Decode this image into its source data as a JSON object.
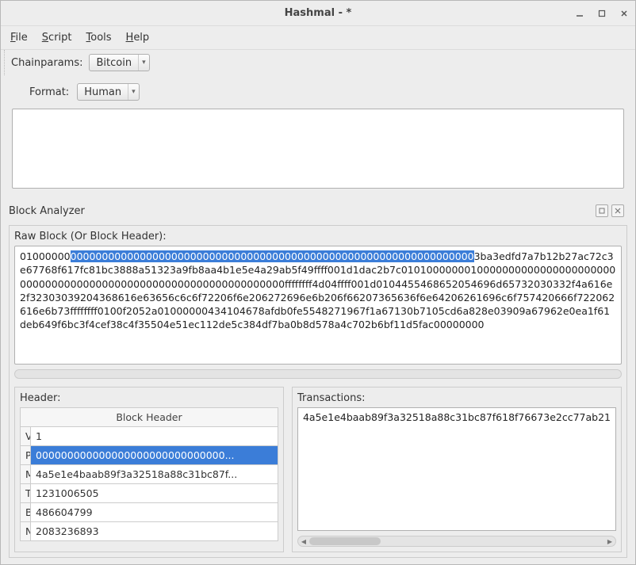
{
  "window": {
    "title": "Hashmal -  *"
  },
  "menu": {
    "file": "File",
    "script": "Script",
    "tools": "Tools",
    "help": "Help"
  },
  "toolbar": {
    "chainparams_label": "Chainparams:",
    "chainparams_value": "Bitcoin"
  },
  "format": {
    "label": "Format:",
    "value": "Human"
  },
  "analyzer": {
    "section_label": "Block Analyzer",
    "raw_label": "Raw Block (Or Block Header):",
    "raw_pre": "01000000",
    "raw_selected": "0000000000000000000000000000000000000000000000000000000000000000",
    "raw_post": "3ba3edfd7a7b12b27ac72c3e67768f617fc81bc3888a51323a9fb8aa4b1e5e4a29ab5f49ffff001d1dac2b7c0101000000010000000000000000000000000000000000000000000000000000000000000000ffffffff4d04ffff001d0104455468652054696d65732030332f4a616e2f32303039204368616e63656c6c6f72206f6e206272696e6b206f66207365636f6e64206261696c6f757420666f722062616e6b73ffffffff0100f2052a01000000434104678afdb0fe5548271967f1a67130b7105cd6a828e03909a67962e0ea1f61deb649f6bc3f4cef38c4f35504e51ec112de5c384df7ba0b8d578a4c702b6bf11d5fac00000000"
  },
  "header_panel": {
    "label": "Header:",
    "table_caption": "Block Header",
    "rows": [
      {
        "key": "Version",
        "value": "1"
      },
      {
        "key": "PrevBlockHash",
        "value": "000000000000000000000000000000..."
      },
      {
        "key": "MerkleRootHash",
        "value": "4a5e1e4baab89f3a32518a88c31bc87f..."
      },
      {
        "key": "Time",
        "value": "1231006505"
      },
      {
        "key": "Bits",
        "value": "486604799"
      },
      {
        "key": "Nonce",
        "value": "2083236893"
      }
    ],
    "selected_index": 1
  },
  "tx_panel": {
    "label": "Transactions:",
    "visible_text": "4a5e1e4baab89f3a32518a88c31bc87f618f76673e2cc77ab21"
  }
}
